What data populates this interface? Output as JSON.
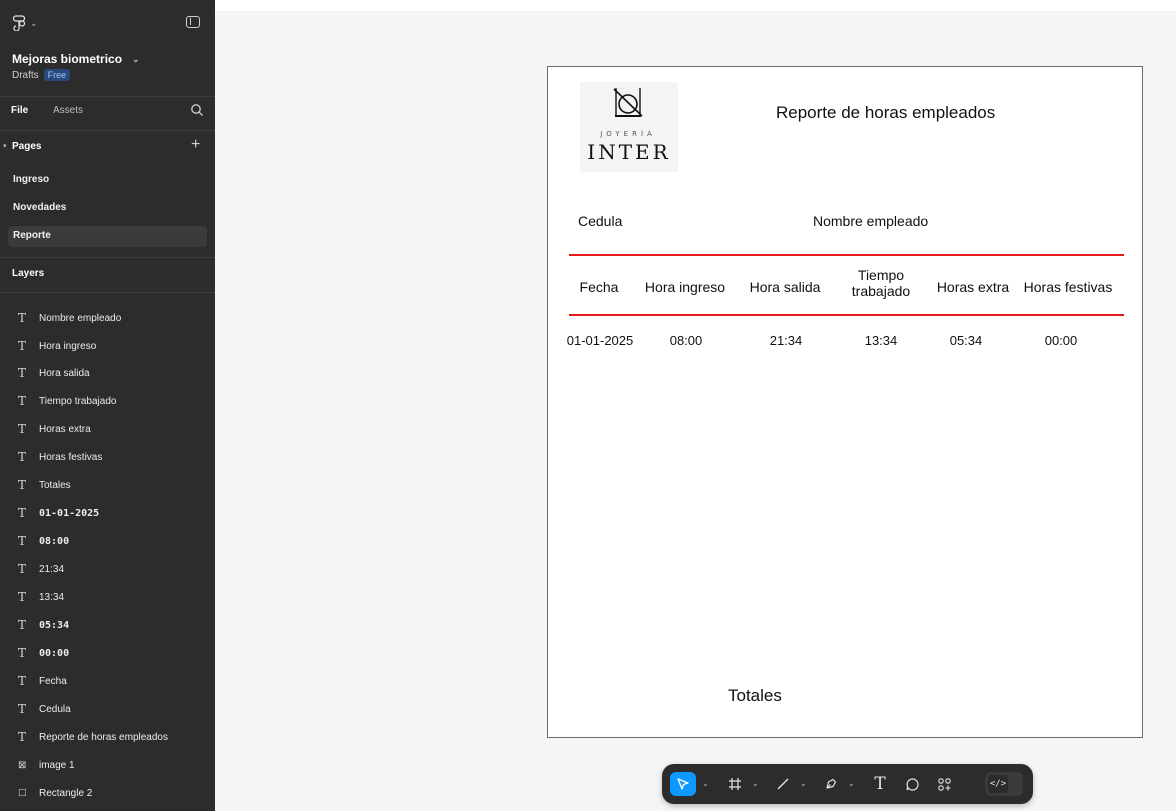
{
  "app": {
    "file_name": "Mejoras biometrico",
    "location": "Drafts",
    "plan_badge": "Free"
  },
  "sidebar": {
    "tabs": {
      "file": "File",
      "assets": "Assets"
    },
    "pages_label": "Pages",
    "pages": [
      "Ingreso",
      "Novedades",
      "Reporte"
    ],
    "active_page": "Reporte",
    "layers_label": "Layers",
    "layers": [
      {
        "icon": "text-icon",
        "label": "Nombre empleado"
      },
      {
        "icon": "text-icon",
        "label": "Hora ingreso"
      },
      {
        "icon": "text-icon",
        "label": "Hora salida"
      },
      {
        "icon": "text-icon",
        "label": "Tiempo trabajado"
      },
      {
        "icon": "text-icon",
        "label": "Horas extra"
      },
      {
        "icon": "text-icon",
        "label": "Horas festivas"
      },
      {
        "icon": "text-icon",
        "label": "Totales"
      },
      {
        "icon": "text-icon",
        "label": "01-01-2025"
      },
      {
        "icon": "text-icon",
        "label": "08:00"
      },
      {
        "icon": "text-icon",
        "label": "21:34"
      },
      {
        "icon": "text-icon",
        "label": "13:34"
      },
      {
        "icon": "text-icon",
        "label": "05:34"
      },
      {
        "icon": "text-icon",
        "label": "00:00"
      },
      {
        "icon": "text-icon",
        "label": "Fecha"
      },
      {
        "icon": "text-icon",
        "label": "Cedula"
      },
      {
        "icon": "text-icon",
        "label": "Reporte de horas empleados"
      },
      {
        "icon": "image-icon",
        "label": "image 1"
      },
      {
        "icon": "rectangle-icon",
        "label": "Rectangle 2"
      }
    ]
  },
  "report": {
    "logo_small_text": "JOYERÍA",
    "logo_big_text": "INTER",
    "title": "Reporte de horas empleados",
    "cedula_label": "Cedula",
    "nombre_label": "Nombre empleado",
    "columns": [
      "Fecha",
      "Hora ingreso",
      "Hora salida",
      "Tiempo trabajado",
      "Horas extra",
      "Horas festivas"
    ],
    "rows": [
      [
        "01-01-2025",
        "08:00",
        "21:34",
        "13:34",
        "05:34",
        "00:00"
      ]
    ],
    "totales_label": "Totales",
    "accent_color": "#e31b1b"
  },
  "toolbar": {
    "tools": [
      "move-tool",
      "frame-tool",
      "line-tool",
      "pen-tool",
      "text-tool",
      "comment-tool",
      "actions-tool"
    ],
    "dev_mode_icon": "</>",
    "active_color": "#0d99ff"
  }
}
